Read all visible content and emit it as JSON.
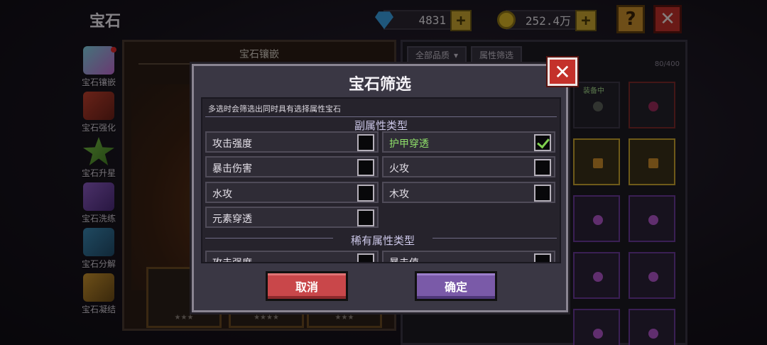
{
  "header": {
    "title": "宝石",
    "gems": "4831",
    "gold": "252.4万",
    "help_label": "?",
    "close_label": "✕"
  },
  "sidebar": {
    "items": [
      {
        "label": "宝石镶嵌",
        "icon": "gem-inlay-icon",
        "badge": true
      },
      {
        "label": "宝石强化",
        "icon": "gem-upgrade-icon"
      },
      {
        "label": "宝石升星",
        "icon": "star-icon"
      },
      {
        "label": "宝石洗练",
        "icon": "gem-refine-icon"
      },
      {
        "label": "宝石分解",
        "icon": "gem-decompose-icon"
      },
      {
        "label": "宝石凝结",
        "icon": "gem-condense-icon"
      }
    ]
  },
  "left_panel": {
    "title": "宝石镶嵌",
    "stars": "★★★",
    "stars4": "★★★★"
  },
  "right_panel": {
    "quality_filter": "全部品质",
    "attr_filter": "属性筛选",
    "count": "80/400",
    "equipped_label": "装备中"
  },
  "modal": {
    "title": "宝石筛选",
    "close_label": "✕",
    "hint": "多选时会筛选出同时具有选择属性宝石",
    "section1": "副属性类型",
    "section2": "稀有属性类型",
    "options": [
      {
        "label": "攻击强度",
        "checked": false
      },
      {
        "label": "护甲穿透",
        "checked": true
      },
      {
        "label": "暴击伤害",
        "checked": false
      },
      {
        "label": "火攻",
        "checked": false
      },
      {
        "label": "水攻",
        "checked": false
      },
      {
        "label": "木攻",
        "checked": false
      },
      {
        "label": "元素穿透",
        "checked": false
      }
    ],
    "rare_options": [
      "攻击强度",
      "暴击值"
    ],
    "cancel_label": "取消",
    "confirm_label": "确定"
  },
  "colors": {
    "accent_check": "#7fd04e",
    "cancel": "#c9474a",
    "confirm": "#7a5aa8"
  }
}
